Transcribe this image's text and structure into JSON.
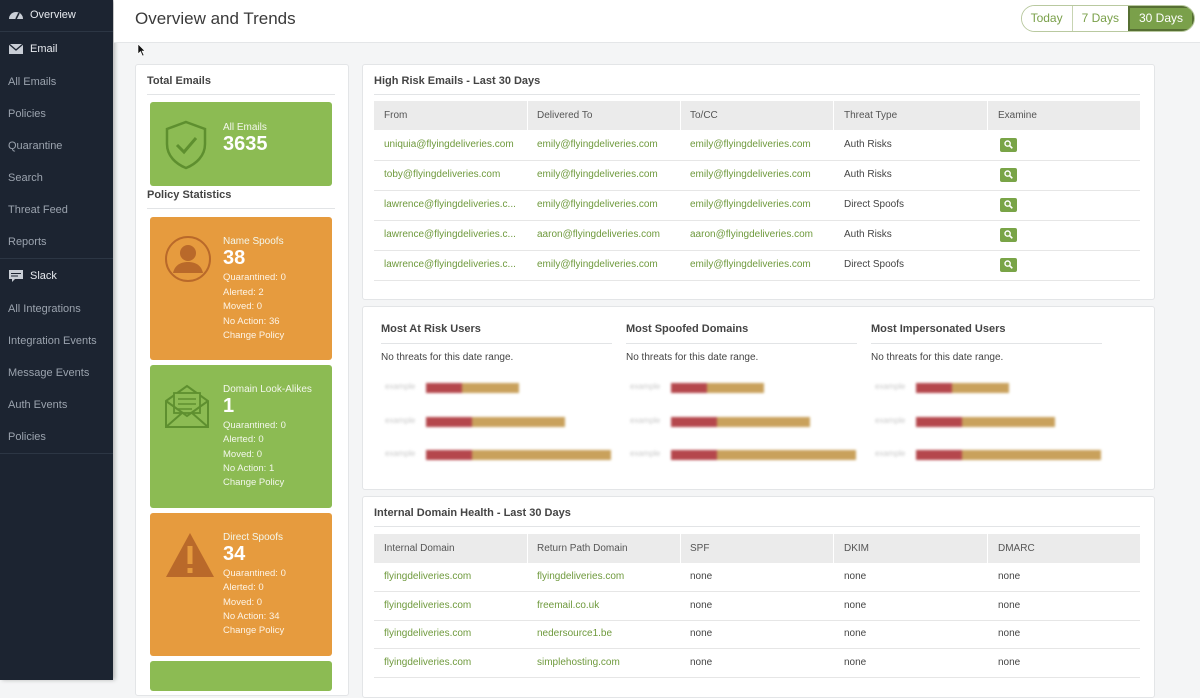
{
  "sidebar": {
    "items": [
      {
        "label": "Overview",
        "icon": "dashboard-icon",
        "section": true
      },
      {
        "label": "Email",
        "icon": "envelope-icon",
        "section": true
      },
      {
        "label": "All Emails"
      },
      {
        "label": "Policies"
      },
      {
        "label": "Quarantine"
      },
      {
        "label": "Search"
      },
      {
        "label": "Threat Feed"
      },
      {
        "label": "Reports"
      },
      {
        "label": "Slack",
        "icon": "chat-icon",
        "section": true
      },
      {
        "label": "All Integrations"
      },
      {
        "label": "Integration Events"
      },
      {
        "label": "Message Events"
      },
      {
        "label": "Auth Events"
      },
      {
        "label": "Policies"
      }
    ]
  },
  "header": {
    "title": "Overview and Trends",
    "ranges": [
      "Today",
      "7 Days",
      "30 Days"
    ],
    "active_range": "30 Days"
  },
  "left": {
    "total_title": "Total Emails",
    "all_emails": {
      "label": "All Emails",
      "value": "3635"
    },
    "policy_title": "Policy Statistics",
    "cards": [
      {
        "label": "Name Spoofs",
        "value": "38",
        "quarantined": "Quarantined: 0",
        "alerted": "Alerted: 2",
        "moved": "Moved: 0",
        "no_action": "No Action: 36",
        "change": "Change Policy"
      },
      {
        "label": "Domain Look-Alikes",
        "value": "1",
        "quarantined": "Quarantined: 0",
        "alerted": "Alerted: 0",
        "moved": "Moved: 0",
        "no_action": "No Action: 1",
        "change": "Change Policy"
      },
      {
        "label": "Direct Spoofs",
        "value": "34",
        "quarantined": "Quarantined: 0",
        "alerted": "Alerted: 0",
        "moved": "Moved: 0",
        "no_action": "No Action: 34",
        "change": "Change Policy"
      }
    ]
  },
  "high_risk": {
    "title": "High Risk Emails - Last 30 Days",
    "columns": [
      "From",
      "Delivered To",
      "To/CC",
      "Threat Type",
      "Examine"
    ],
    "rows": [
      [
        "uniquia@flyingdeliveries.com",
        "emily@flyingdeliveries.com",
        "emily@flyingdeliveries.com",
        "Auth Risks"
      ],
      [
        "toby@flyingdeliveries.com",
        "emily@flyingdeliveries.com",
        "emily@flyingdeliveries.com",
        "Auth Risks"
      ],
      [
        "lawrence@flyingdeliveries.c...",
        "emily@flyingdeliveries.com",
        "emily@flyingdeliveries.com",
        "Direct Spoofs"
      ],
      [
        "lawrence@flyingdeliveries.c...",
        "aaron@flyingdeliveries.com",
        "aaron@flyingdeliveries.com",
        "Auth Risks"
      ],
      [
        "lawrence@flyingdeliveries.c...",
        "emily@flyingdeliveries.com",
        "emily@flyingdeliveries.com",
        "Direct Spoofs"
      ]
    ]
  },
  "mini_charts": [
    {
      "title": "Most At Risk Users",
      "empty": "No threats for this date range.",
      "placeholder": "example"
    },
    {
      "title": "Most Spoofed Domains",
      "empty": "No threats for this date range.",
      "placeholder": "example"
    },
    {
      "title": "Most Impersonated Users",
      "empty": "No threats for this date range.",
      "placeholder": "example"
    }
  ],
  "domain_health": {
    "title": "Internal Domain Health - Last 30 Days",
    "columns": [
      "Internal Domain",
      "Return Path Domain",
      "SPF",
      "DKIM",
      "DMARC"
    ],
    "rows": [
      [
        "flyingdeliveries.com",
        "flyingdeliveries.com",
        "none",
        "none",
        "none"
      ],
      [
        "flyingdeliveries.com",
        "freemail.co.uk",
        "none",
        "none",
        "none"
      ],
      [
        "flyingdeliveries.com",
        "nedersource1.be",
        "none",
        "none",
        "none"
      ],
      [
        "flyingdeliveries.com",
        "simplehosting.com",
        "none",
        "none",
        "none"
      ]
    ]
  },
  "colors": {
    "accent": "#7aa04a",
    "card_green": "#8cbb53",
    "card_orange": "#e69b3e",
    "sidebar": "#1c2431"
  }
}
